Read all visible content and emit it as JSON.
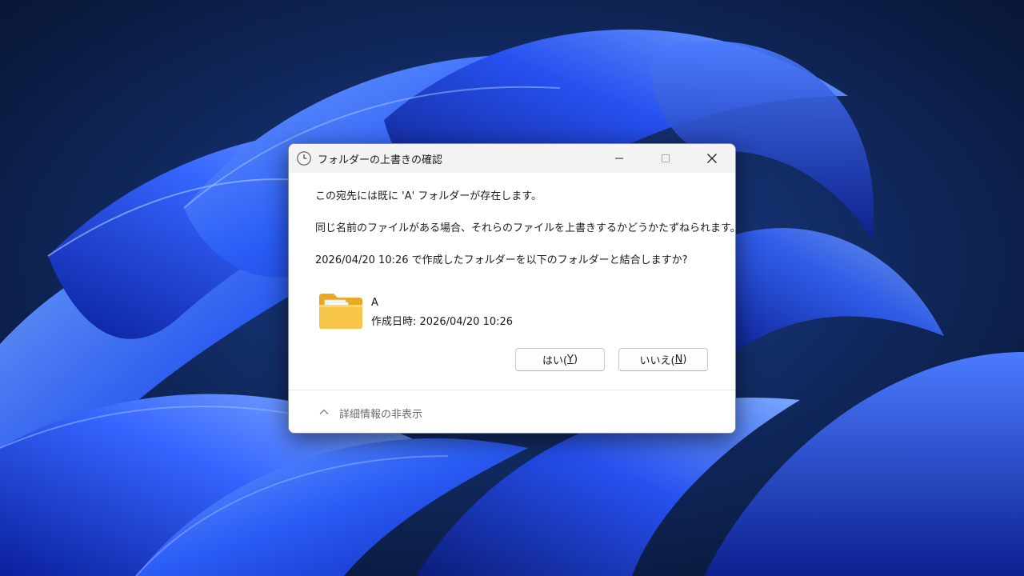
{
  "dialog": {
    "title": "フォルダーの上書きの確認",
    "message_line1": "この宛先には既に 'A' フォルダーが存在します。",
    "message_line2": "同じ名前のファイルがある場合、それらのファイルを上書きするかどうかたずねられます。",
    "message_line3": "2026/04/20 10:26 で作成したフォルダーを以下のフォルダーと結合しますか?",
    "folder": {
      "name": "A",
      "created": "作成日時: 2026/04/20 10:26",
      "icon": "folder-icon"
    },
    "buttons": {
      "yes_text": "はい(",
      "yes_key": "Y",
      "yes_end": ")",
      "no_text": "いいえ(",
      "no_key": "N",
      "no_end": ")"
    },
    "details_toggle": "詳細情報の非表示"
  },
  "icons": {
    "title": "clock-icon",
    "minimize": "minimize-icon",
    "maximize": "maximize-icon",
    "close": "close-icon",
    "details": "chevron-up-icon"
  },
  "colors": {
    "desktop_background": "#0b1a3a",
    "wallpaper_accent": "#1f4ef5",
    "folder_yellow": "#f5c242"
  }
}
